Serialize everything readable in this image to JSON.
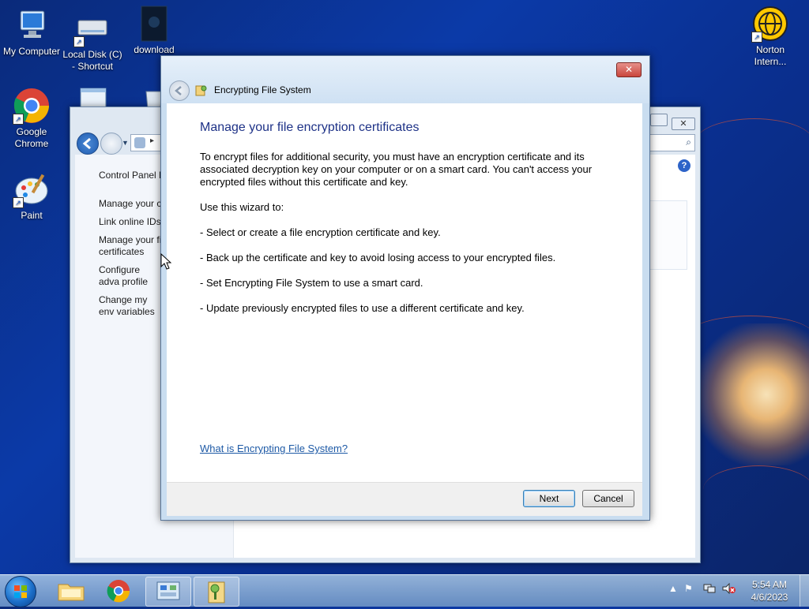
{
  "desktop": {
    "icons": [
      {
        "label": "My Computer"
      },
      {
        "label": "Local Disk (C) - Shortcut"
      },
      {
        "label": "download"
      },
      {
        "label": "Google Chrome"
      },
      {
        "label": "Paint"
      },
      {
        "label": "Norton Intern..."
      }
    ]
  },
  "control_panel": {
    "left_links": [
      "Control Panel H",
      "Manage your c",
      "Link online IDs",
      "Manage your fi certificates",
      "Configure adva profile properti",
      "Change my env variables"
    ]
  },
  "dialog": {
    "title": "Encrypting File System",
    "heading": "Manage your file encryption certificates",
    "intro": "To encrypt files for additional security, you must have an encryption certificate and its associated decryption key on your computer or on a smart card. You can't access your encrypted files without this certificate and key.",
    "use_wizard": "Use this wizard to:",
    "bullets": [
      "- Select or create a file encryption certificate and key.",
      "- Back up the certificate and key to avoid losing access to your encrypted files.",
      "- Set Encrypting File System to use a smart card.",
      "- Update previously encrypted files to use a different certificate and key."
    ],
    "help_link": "What is Encrypting File System?",
    "next_label": "Next",
    "cancel_label": "Cancel"
  },
  "taskbar": {
    "time": "5:54 AM",
    "date": "4/6/2023",
    "pinned": [
      "start-orb",
      "file-explorer",
      "google-chrome",
      "control-panel",
      "encrypting-file-system"
    ]
  },
  "colors": {
    "heading": "#1e3287",
    "link": "#1e5aa6",
    "close": "#c9463d"
  }
}
